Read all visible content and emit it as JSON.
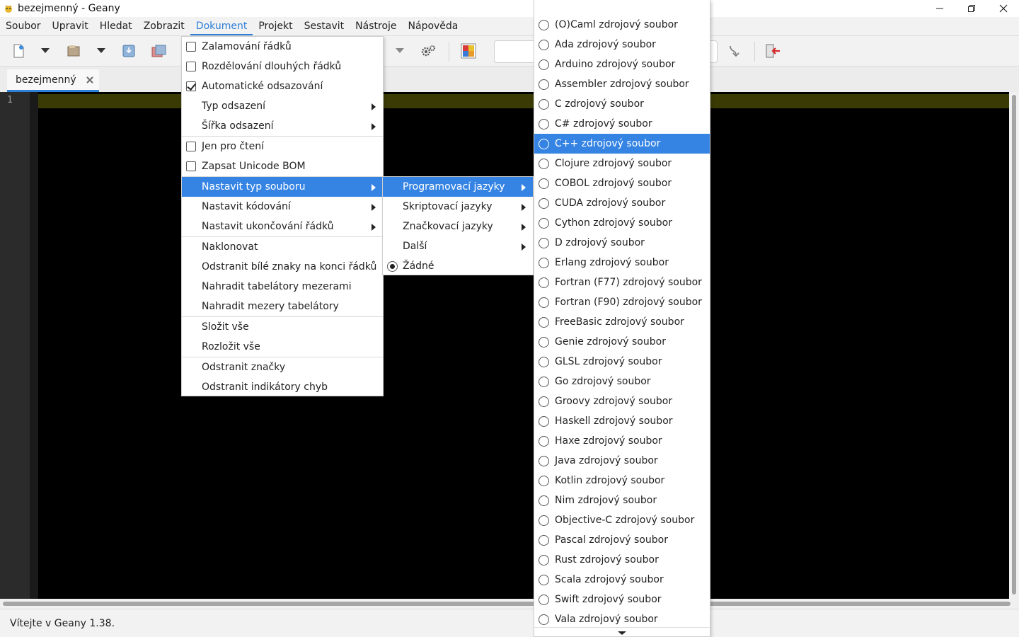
{
  "window": {
    "title": "bezejmenný - Geany"
  },
  "menubar": [
    {
      "label": "Soubor",
      "active": false
    },
    {
      "label": "Upravit",
      "active": false
    },
    {
      "label": "Hledat",
      "active": false
    },
    {
      "label": "Zobrazit",
      "active": false
    },
    {
      "label": "Dokument",
      "active": true
    },
    {
      "label": "Projekt",
      "active": false
    },
    {
      "label": "Sestavit",
      "active": false
    },
    {
      "label": "Nástroje",
      "active": false
    },
    {
      "label": "Nápověda",
      "active": false
    }
  ],
  "toolbar": {
    "icons": [
      "new-file-icon",
      "dropdown-icon",
      "open-file-icon",
      "dropdown-icon",
      "save-icon",
      "save-all-icon",
      "dropdown-icon",
      "preferences-gear-icon",
      "color-chooser-icon",
      "jump-to-line-icon",
      "quit-icon"
    ]
  },
  "tab": {
    "label": "bezejmenný"
  },
  "editor": {
    "line_number": "1"
  },
  "status": {
    "message": "Vítejte v Geany 1.38."
  },
  "dokument_menu": {
    "items": [
      {
        "label": "Zalamování řádků",
        "kind": "check",
        "checked": false
      },
      {
        "label": "Rozdělování dlouhých řádků",
        "kind": "check",
        "checked": false
      },
      {
        "label": "Automatické odsazování",
        "kind": "check",
        "checked": true
      },
      {
        "label": "Typ odsazení",
        "kind": "submenu"
      },
      {
        "label": "Šířka odsazení",
        "kind": "submenu"
      },
      {
        "label": "Jen pro čtení",
        "kind": "check",
        "checked": false
      },
      {
        "label": "Zapsat Unicode BOM",
        "kind": "check",
        "checked": false
      },
      {
        "label": "Nastavit typ souboru",
        "kind": "submenu",
        "highlighted": true
      },
      {
        "label": "Nastavit kódování",
        "kind": "submenu"
      },
      {
        "label": "Nastavit ukončování řádků",
        "kind": "submenu"
      },
      {
        "label": "Naklonovat",
        "kind": "plain"
      },
      {
        "label": "Odstranit bílé znaky na konci řádků",
        "kind": "plain"
      },
      {
        "label": "Nahradit tabelátory mezerami",
        "kind": "plain"
      },
      {
        "label": "Nahradit mezery tabelátory",
        "kind": "plain"
      },
      {
        "label": "Složit vše",
        "kind": "plain"
      },
      {
        "label": "Rozložit vše",
        "kind": "plain"
      },
      {
        "label": "Odstranit značky",
        "kind": "plain"
      },
      {
        "label": "Odstranit indikátory chyb",
        "kind": "plain"
      }
    ]
  },
  "typ_menu": {
    "items": [
      {
        "label": "Programovací jazyky",
        "kind": "submenu",
        "highlighted": true
      },
      {
        "label": "Skriptovací jazyky",
        "kind": "submenu"
      },
      {
        "label": "Značkovací jazyky",
        "kind": "submenu"
      },
      {
        "label": "Další",
        "kind": "submenu"
      },
      {
        "label": "Žádné",
        "kind": "radio",
        "checked": true
      }
    ]
  },
  "prog_menu": {
    "highlighted_index": 6,
    "items": [
      "(O)Caml zdrojový soubor",
      "Ada zdrojový soubor",
      "Arduino zdrojový soubor",
      "Assembler zdrojový soubor",
      "C zdrojový soubor",
      "C# zdrojový soubor",
      "C++ zdrojový soubor",
      "Clojure zdrojový soubor",
      "COBOL zdrojový soubor",
      "CUDA zdrojový soubor",
      "Cython zdrojový soubor",
      "D zdrojový soubor",
      "Erlang zdrojový soubor",
      "Fortran (F77) zdrojový soubor",
      "Fortran (F90) zdrojový soubor",
      "FreeBasic zdrojový soubor",
      "Genie zdrojový soubor",
      "GLSL zdrojový soubor",
      "Go zdrojový soubor",
      "Groovy zdrojový soubor",
      "Haskell zdrojový soubor",
      "Haxe zdrojový soubor",
      "Java zdrojový soubor",
      "Kotlin zdrojový soubor",
      "Nim zdrojový soubor",
      "Objective-C zdrojový soubor",
      "Pascal zdrojový soubor",
      "Rust zdrojový soubor",
      "Scala zdrojový soubor",
      "Swift zdrojový soubor",
      "Vala zdrojový soubor"
    ]
  },
  "colors": {
    "accent": "#3584e4",
    "menu_active": "#2d7fd8",
    "editor_bg": "#000000",
    "current_line": "#3a3a05"
  }
}
